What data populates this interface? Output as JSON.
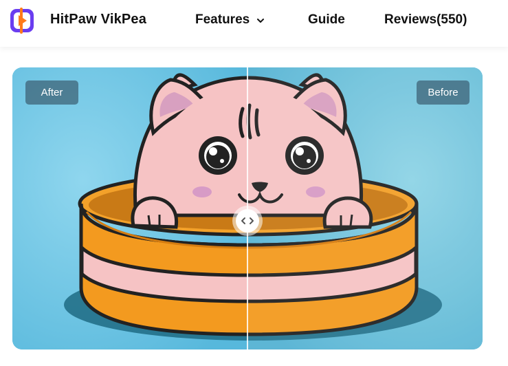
{
  "header": {
    "brand": "HitPaw VikPea",
    "logo_icon": "hitpaw-logo-icon",
    "nav": [
      {
        "label": "Features",
        "has_dropdown": true
      },
      {
        "label": "Guide"
      },
      {
        "label": "Reviews(550)"
      }
    ]
  },
  "comparison": {
    "after_label": "After",
    "before_label": "Before",
    "handle_icon": "drag-arrows-icon",
    "split_percent": 50
  },
  "colors": {
    "logo_purple": "#6a3df0",
    "logo_orange": "#ff7a1a",
    "bg_left": "#6fc6e6",
    "bg_right": "#6cc3dd",
    "label_bg": "#3c5f73"
  }
}
